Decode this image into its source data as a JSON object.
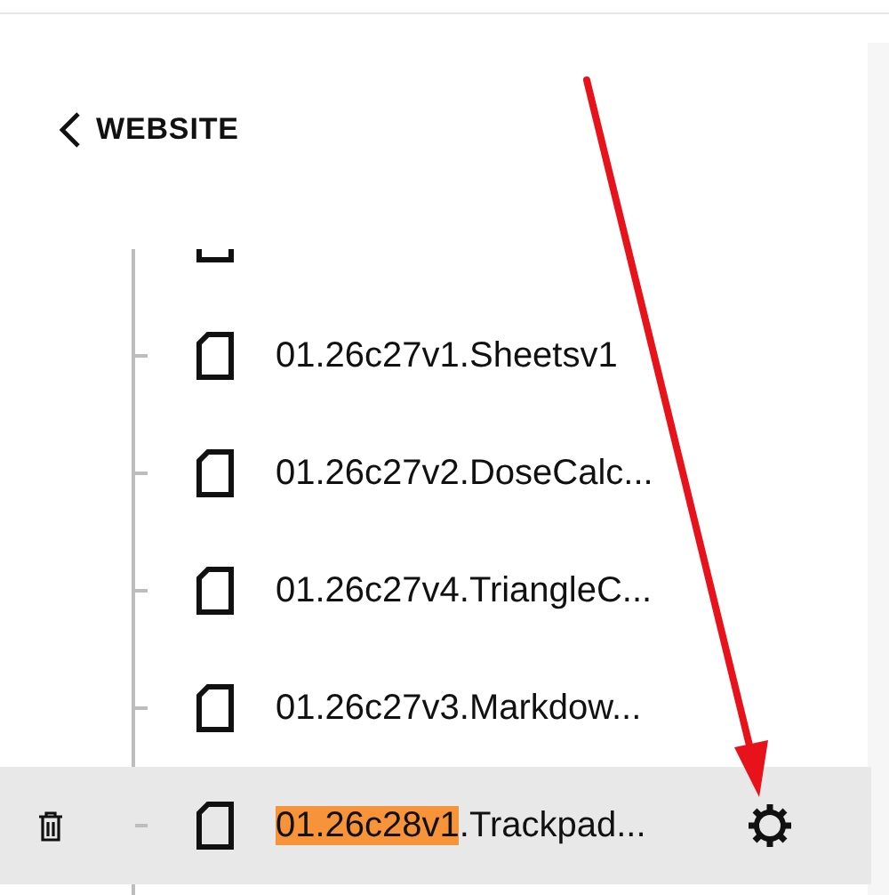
{
  "back_link": {
    "label": "WEBSITE"
  },
  "items": [
    {
      "selected": false
    },
    {
      "label": "01.26c27v1.Sheetsv1",
      "selected": false
    },
    {
      "label": "01.26c27v2.DoseCalc...",
      "selected": false
    },
    {
      "label": "01.26c27v4.TriangleC...",
      "selected": false
    },
    {
      "label": "01.26c27v3.Markdow...",
      "selected": false
    },
    {
      "label_match": "01.26c28v1",
      "label": ".Trackpad...",
      "selected": true
    }
  ]
}
